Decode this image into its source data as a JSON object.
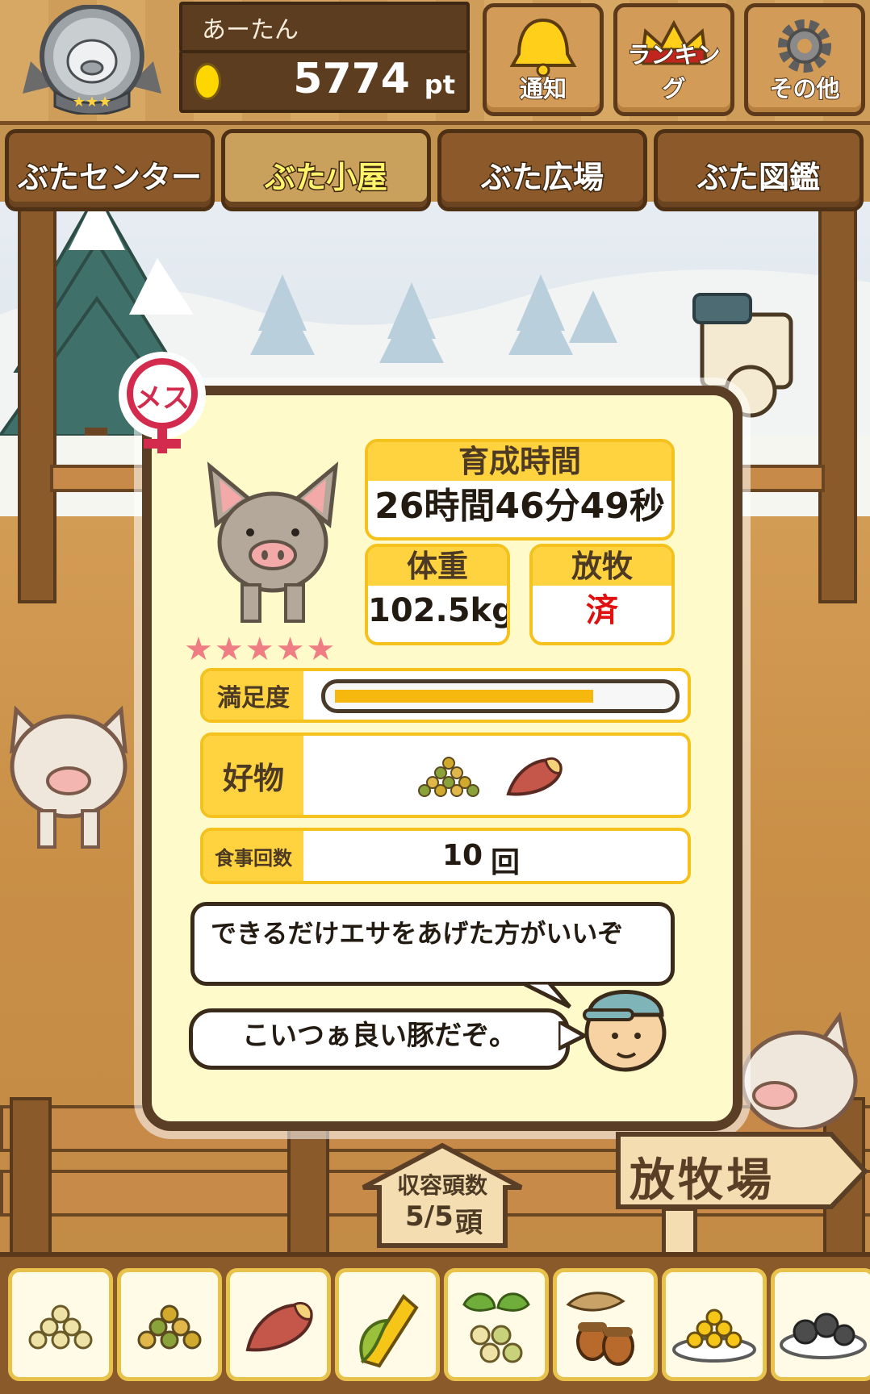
{
  "user": {
    "name": "あーたん",
    "points": "5774",
    "points_unit": "pt",
    "rank_stars": 3
  },
  "header_buttons": [
    {
      "label": "通知",
      "icon": "bell-icon"
    },
    {
      "label": "ランキング",
      "icon": "crown-icon"
    },
    {
      "label": "その他",
      "icon": "gear-icon"
    }
  ],
  "tabs": [
    {
      "label": "ぶたセンター",
      "active": false
    },
    {
      "label": "ぶた小屋",
      "active": true
    },
    {
      "label": "ぶた広場",
      "active": false
    },
    {
      "label": "ぶた図鑑",
      "active": false
    }
  ],
  "pig": {
    "gender_label": "メス",
    "stars": 5,
    "stat_labels": {
      "raise_time": "育成時間",
      "weight": "体重",
      "grazing": "放牧"
    },
    "raise_time": "26時間46分49秒",
    "weight": "102.5kg",
    "grazing": "済",
    "satisfaction_label": "満足度",
    "satisfaction_level": 0.78,
    "favorite_label": "好物",
    "favorites": [
      "mixed-grain-icon",
      "sweet-potato-icon"
    ],
    "meals_label": "食事回数",
    "meals_value": "10",
    "meals_unit": "回"
  },
  "advice_text": "できるだけエサをあげた方がいいぞ",
  "farmer_comment": "こいつぁ良い豚だぞ。",
  "capacity": {
    "label": "収容頭数",
    "value": "5/5",
    "unit": "頭"
  },
  "ranch_sign": "放牧場",
  "feeds": [
    "grain-pile-icon",
    "mixed-grain-icon",
    "sweet-potato-icon",
    "corn-icon",
    "beans-leaf-icon",
    "acorn-icon",
    "grain-plate-icon",
    "dark-balls-plate-icon"
  ],
  "colors": {
    "accent_yellow": "#ffd23f",
    "grazing_done": "#e01010",
    "wood_dark": "#5a3f26"
  }
}
